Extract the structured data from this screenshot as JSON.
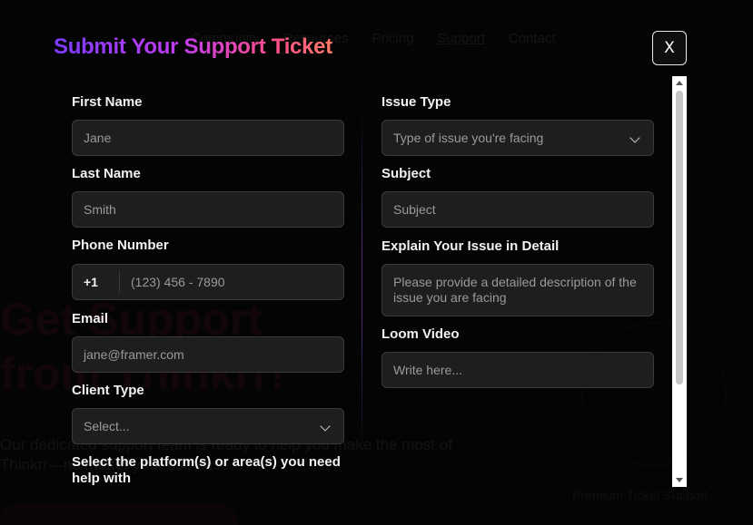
{
  "background": {
    "nav": [
      "Community",
      "Resources",
      "Pricing",
      "Support",
      "Contact"
    ],
    "hero": [
      "Get Support",
      "from Thinkrr!"
    ],
    "subtitle": "Our dedicated support team is ready to help you make the most of Thinkrr—no matter your use case.",
    "caption": "Premium Ticket Support"
  },
  "modal": {
    "title": "Submit Your Support Ticket",
    "close_label": "X"
  },
  "form": {
    "first_name": {
      "label": "First Name",
      "placeholder": "Jane"
    },
    "last_name": {
      "label": "Last Name",
      "placeholder": "Smith"
    },
    "phone": {
      "label": "Phone Number",
      "prefix": "+1",
      "placeholder": "(123) 456 - 7890"
    },
    "email": {
      "label": "Email",
      "placeholder": "jane@framer.com"
    },
    "client_type": {
      "label": "Client Type",
      "selected": "Select..."
    },
    "platform": {
      "label": "Select the platform(s) or area(s) you need help with"
    },
    "issue_type": {
      "label": "Issue Type",
      "selected": "Type of issue you're facing"
    },
    "subject": {
      "label": "Subject",
      "placeholder": "Subject"
    },
    "detail": {
      "label": "Explain Your Issue in Detail",
      "placeholder": "Please provide a detailed description of the issue you are facing"
    },
    "loom": {
      "label": "Loom Video",
      "placeholder": "Write here..."
    }
  },
  "colors": {
    "title_gradient": [
      "#7b3cff",
      "#c13cf0",
      "#ff4f88",
      "#ff7a66"
    ],
    "field_bg": "#1e1e20",
    "field_border": "#3a3a3c"
  }
}
